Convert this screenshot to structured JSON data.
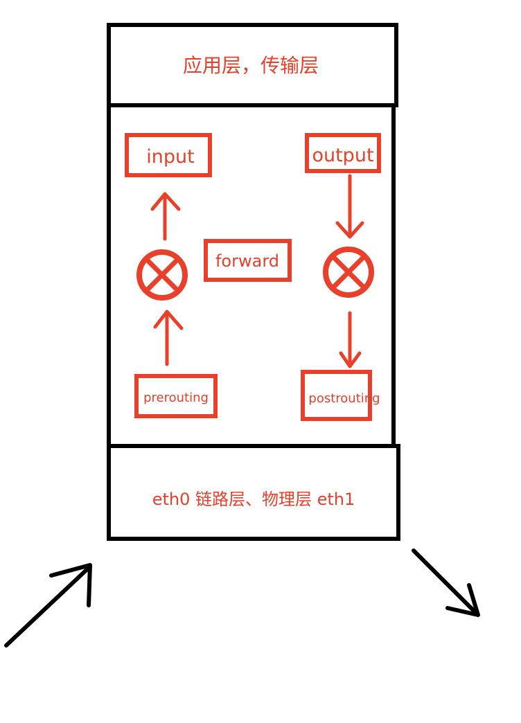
{
  "colors": {
    "stroke": "#000000",
    "accent": "#e8402a",
    "background": "#ffffff"
  },
  "layers": {
    "top": "应用层，传输层",
    "bottom": "eth0 链路层、物理层 eth1"
  },
  "chains": {
    "input": "input",
    "output": "output",
    "forward": "forward",
    "prerouting": "prerouting",
    "postrouting": "postrouting"
  },
  "icons": {
    "routing_left": "routing-decision-icon",
    "routing_right": "routing-decision-icon"
  }
}
